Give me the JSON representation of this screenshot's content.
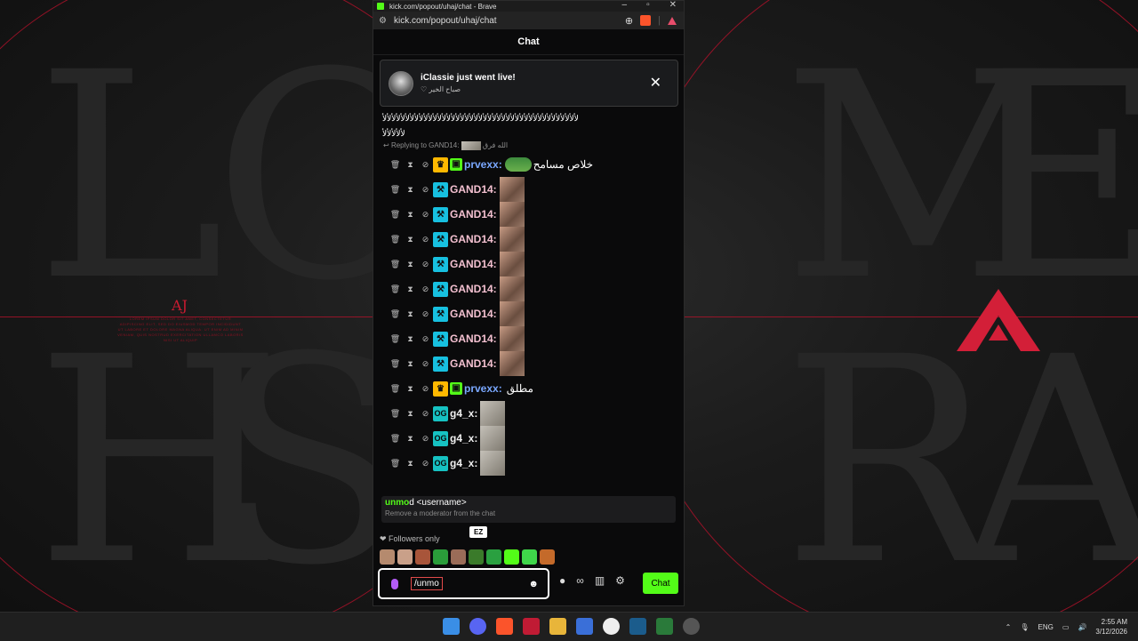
{
  "browser": {
    "title": "kick.com/popout/uhaj/chat - Brave",
    "url": "kick.com/popout/uhaj/chat",
    "badge_count": "1"
  },
  "chat": {
    "header": "Chat",
    "live_banner": {
      "name": "iClassie",
      "suffix": " just went live!",
      "subtitle": "♡ صباح الخير"
    },
    "spam_line": "ﻷﻷﻷﻷﻷﻷﻷﻷﻷﻷﻷﻷﻷﻷﻷﻷﻷﻷﻷﻷﻷﻷﻷﻷﻷﻷﻷﻷﻷﻷﻷﻷﻷﻷﻷﻷﻷﻷﻷﻷﻷﻷﻷ",
    "spam_line2": "ﻷﻷﻷﻷﻷ",
    "reply": "Replying to GAND14:",
    "reply_tail": "الله فرق",
    "messages": [
      {
        "user": "prvexx:",
        "text": "خلاص مسامح",
        "type": "vip"
      },
      {
        "user": "GAND14:",
        "text": "",
        "type": "mod"
      },
      {
        "user": "GAND14:",
        "text": "",
        "type": "mod"
      },
      {
        "user": "GAND14:",
        "text": "",
        "type": "mod"
      },
      {
        "user": "GAND14:",
        "text": "",
        "type": "mod"
      },
      {
        "user": "GAND14:",
        "text": "",
        "type": "mod"
      },
      {
        "user": "GAND14:",
        "text": "",
        "type": "mod"
      },
      {
        "user": "GAND14:",
        "text": "",
        "type": "mod"
      },
      {
        "user": "GAND14:",
        "text": "",
        "type": "mod"
      },
      {
        "user": "prvexx:",
        "text": "مطلق",
        "type": "vip"
      },
      {
        "user": "g4_x:",
        "text": "",
        "type": "og"
      },
      {
        "user": "g4_x:",
        "text": "",
        "type": "og"
      },
      {
        "user": "g4_x:",
        "text": "",
        "type": "og"
      }
    ],
    "command": {
      "typed_part": "unmo",
      "rest": "d <username>",
      "description": "Remove a moderator from the chat"
    },
    "followers_only": "Followers only",
    "emote_tooltip": "EZ",
    "input_value": "/unmo",
    "send_label": "Chat",
    "points_label": "∞"
  },
  "overlay": {
    "aj_logo": "AJ",
    "aj_text": "LOREM IPSUM DOLOR SIT AMET, CONSECTETUR ADIPISCING ELIT, SED DO EIUSMOD TEMPOR INCIDIDUNT UT LABORE ET DOLORE MAGNA ALIQUA. UT ENIM AD MINIM VENIAM, QUIS NOSTRUD EXERCITATION ULLAMCO LABORIS NISI UT ALIQUIP"
  },
  "taskbar": {
    "lang": "ENG",
    "time": "2:55 AM",
    "date": "3/12/2026"
  },
  "colors": {
    "kick_green": "#53fc18",
    "accent_red": "#b3122a"
  }
}
